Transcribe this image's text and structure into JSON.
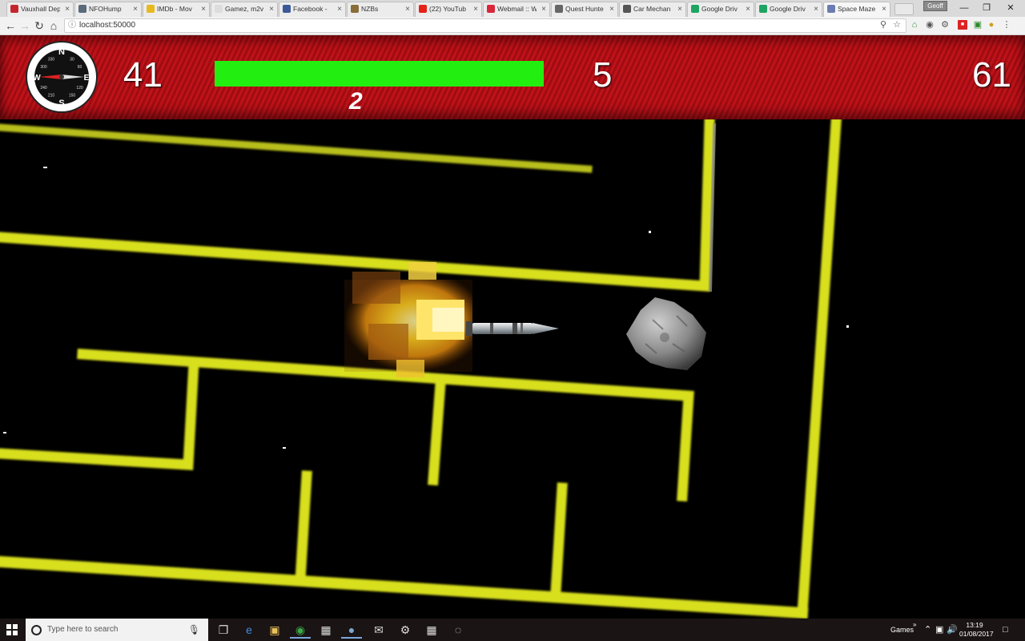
{
  "browser": {
    "tabs": [
      {
        "title": "Vauxhall Dep",
        "favicon_color": "#c3272d"
      },
      {
        "title": "NFOHump",
        "favicon_color": "#5a6b7a"
      },
      {
        "title": "IMDb - Mov",
        "favicon_color": "#e6b91e"
      },
      {
        "title": "Gamez, m2v",
        "favicon_color": "#dddddd"
      },
      {
        "title": "Facebook -",
        "favicon_color": "#3b5998"
      },
      {
        "title": "NZBs",
        "favicon_color": "#8a6d3b"
      },
      {
        "title": "(22) YouTub",
        "favicon_color": "#e62117"
      },
      {
        "title": "Webmail :: W",
        "favicon_color": "#d9263b"
      },
      {
        "title": "Quest Hunte",
        "favicon_color": "#666666"
      },
      {
        "title": "Car Mechan",
        "favicon_color": "#555555"
      },
      {
        "title": "Google Driv",
        "favicon_color": "#1fa463"
      },
      {
        "title": "Google Driv",
        "favicon_color": "#1fa463"
      },
      {
        "title": "Space Maze",
        "favicon_color": "#6b7cb0",
        "active": true
      }
    ],
    "profile_label": "Geoff",
    "url": "localhost:50000"
  },
  "hud": {
    "compass": {
      "north": "N",
      "south": "S",
      "east": "E",
      "west": "W",
      "degrees": [
        "30",
        "60",
        "120",
        "150",
        "210",
        "240",
        "300",
        "330"
      ]
    },
    "left_value": "41",
    "health_fraction": 1.0,
    "health_color": "#22ee10",
    "level": "2",
    "center_value": "5",
    "right_value": "61"
  },
  "colors": {
    "maze_wall": "#d8df1c",
    "hud_red": "#b0101a"
  },
  "taskbar": {
    "search_placeholder": "Type here to search",
    "tray_label": "Games",
    "time": "13:19",
    "date": "01/08/2017"
  }
}
